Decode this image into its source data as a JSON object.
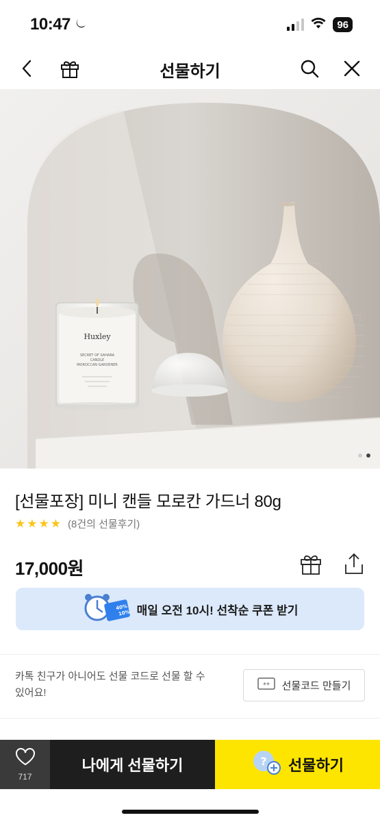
{
  "status": {
    "time": "10:47",
    "battery": "96"
  },
  "nav": {
    "title": "선물하기"
  },
  "hero": {
    "candle_brand": "Huxley",
    "candle_line1": "SECRET OF SAHARA",
    "candle_line2": "CANDLE",
    "candle_line3": "MOROCCAN GARDENER",
    "image_page": 2,
    "image_count": 2
  },
  "product": {
    "title": "[선물포장] 미니 캔들 모로칸 가드너 80g",
    "rating_stars": 4,
    "review_count": "(8건의 선물후기)",
    "price": "17,000원"
  },
  "coupon": {
    "text": "매일 오전 10시! 선착순 쿠폰 받기",
    "badge_top": "40%",
    "badge_bottom": "10%"
  },
  "gift_code": {
    "description": "카톡 친구가 아니어도 선물 코드로 선물 할 수 있어요!",
    "button_label": "선물코드 만들기",
    "button_icon_text": "**"
  },
  "bottom_bar": {
    "like_count": "717",
    "gift_me_label": "나에게 선물하기",
    "gift_label": "선물하기"
  },
  "colors": {
    "accent_yellow": "#fee500",
    "dark": "#1e1e1e",
    "coupon_bg": "#dbe9fb",
    "star": "#fcc419"
  }
}
